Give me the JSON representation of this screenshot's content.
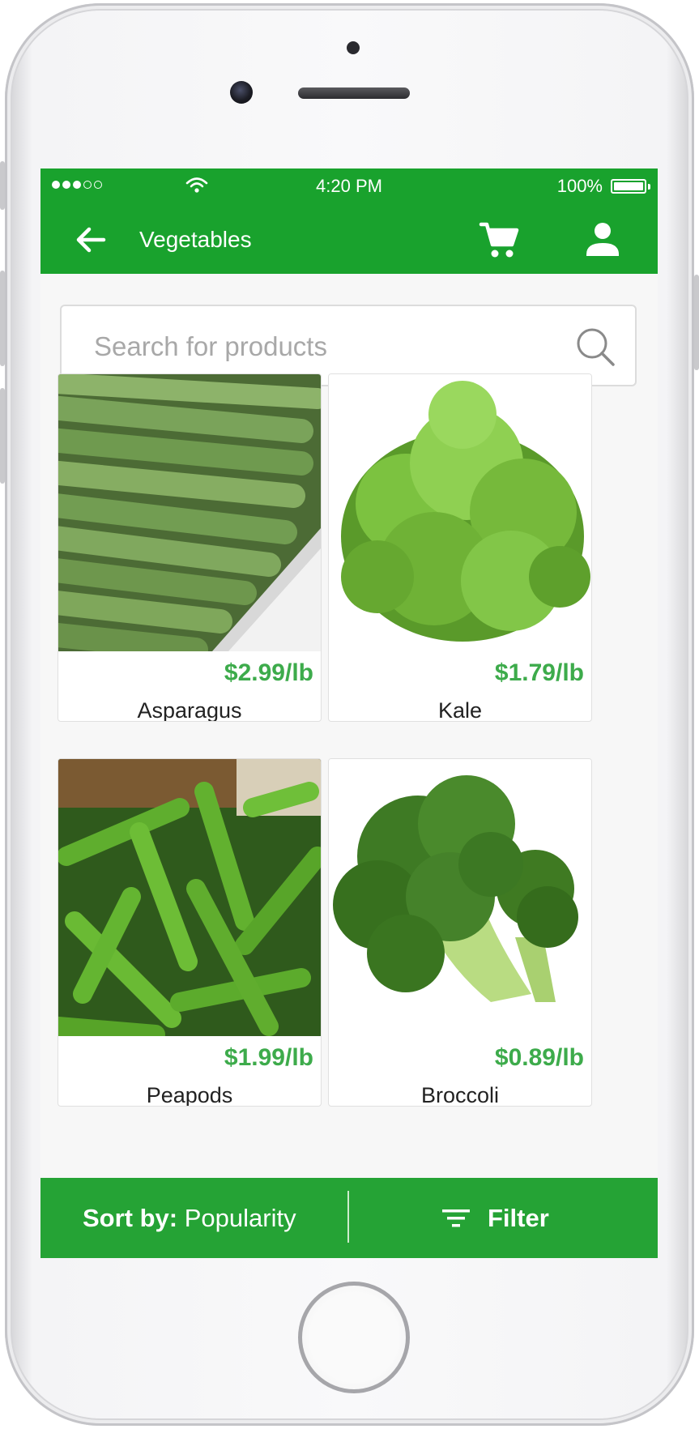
{
  "status_bar": {
    "time": "4:20 PM",
    "battery": "100%"
  },
  "app_bar": {
    "title": "Vegetables",
    "back_icon": "arrow-left-icon",
    "cart_icon": "shopping-cart-icon",
    "account_icon": "person-icon"
  },
  "search": {
    "placeholder": "Search for products",
    "value": "",
    "icon": "search-icon"
  },
  "products": [
    {
      "name": "Asparagus",
      "price": "$2.99/lb"
    },
    {
      "name": "Kale",
      "price": "$1.79/lb"
    },
    {
      "name": "Peapods",
      "price": "$1.99/lb"
    },
    {
      "name": "Broccoli",
      "price": "$0.89/lb"
    }
  ],
  "bottom_bar": {
    "sort_prefix": "Sort by:",
    "sort_value": "Popularity",
    "filter_label": "Filter",
    "filter_icon": "filter-lines-icon"
  },
  "colors": {
    "primary": "#19a22d",
    "price": "#3dab4b",
    "background": "#f7f7f7"
  }
}
